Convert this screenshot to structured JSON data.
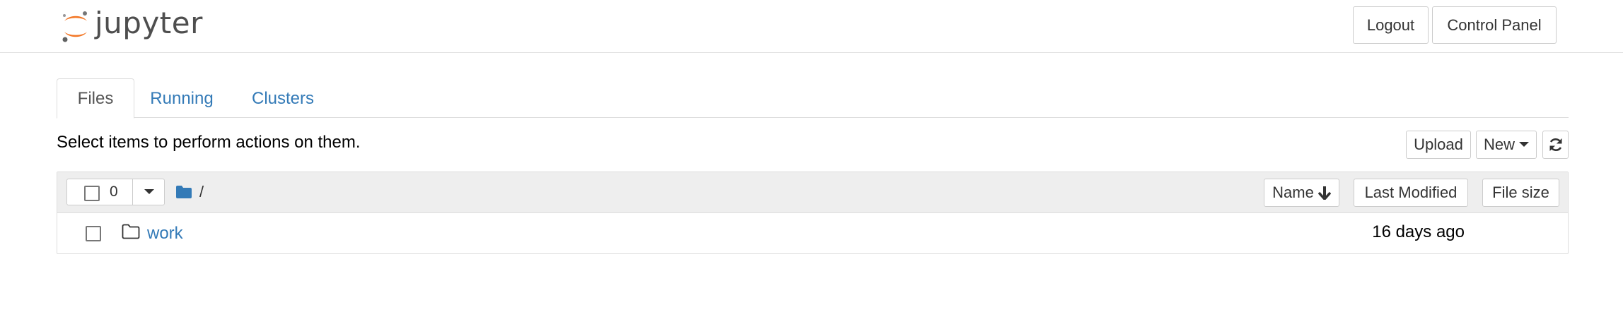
{
  "header": {
    "logo_text": "jupyter",
    "buttons": {
      "logout": "Logout",
      "control_panel": "Control Panel"
    }
  },
  "tabs": [
    {
      "label": "Files",
      "active": true
    },
    {
      "label": "Running",
      "active": false
    },
    {
      "label": "Clusters",
      "active": false
    }
  ],
  "toolbar": {
    "instructions": "Select items to perform actions on them.",
    "upload_label": "Upload",
    "new_label": "New",
    "refresh_icon": "refresh-icon"
  },
  "list": {
    "selected_count": "0",
    "breadcrumb_separator": "/",
    "columns": {
      "name": "Name",
      "last_modified": "Last Modified",
      "file_size": "File size"
    },
    "items": [
      {
        "name": "work",
        "type": "folder",
        "last_modified": "16 days ago",
        "file_size": ""
      }
    ]
  },
  "colors": {
    "link": "#337ab7",
    "logo_orange": "#f37726",
    "logo_gray": "#4e4e4e",
    "header_bg": "#eeeeee"
  }
}
